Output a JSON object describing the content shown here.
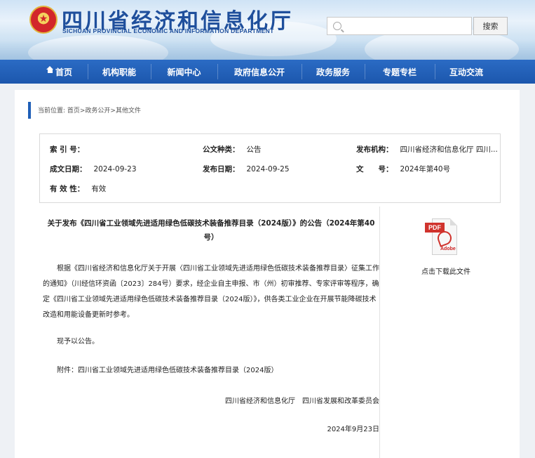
{
  "header": {
    "title": "四川省经济和信息化厅",
    "subtitle": "SICHUAN PROVINCIAL ECONOMIC AND INFORMATION DEPARTMENT",
    "search_placeholder": "",
    "search_button": "搜索"
  },
  "nav": {
    "items": [
      "首页",
      "机构职能",
      "新闻中心",
      "政府信息公开",
      "政务服务",
      "专题专栏",
      "互动交流"
    ]
  },
  "breadcrumb": "当前位置: 首页>政务公开>其他文件",
  "meta": {
    "index_label": "索 引 号：",
    "index_value": "",
    "category_label": "公文种类：",
    "category_value": "公告",
    "publisher_label": "发布机构：",
    "publisher_value": "四川省经济和信息化厅 四川...",
    "created_label": "成文日期：",
    "created_value": "2024-09-23",
    "published_label": "发布日期：",
    "published_value": "2024-09-25",
    "docno_label": "文　　号：",
    "docno_value": "2024年第40号",
    "validity_label": "有 效 性：",
    "validity_value": "有效"
  },
  "document": {
    "title": "关于发布《四川省工业领域先进适用绿色低碳技术装备推荐目录（2024版）》的公告（2024年第40号）",
    "body": "根据《四川省经济和信息化厅关于开展〈四川省工业领域先进适用绿色低碳技术装备推荐目录〉征集工作的通知》（川经信环资函〔2023〕284号）要求，经企业自主申报、市（州）初审推荐、专家评审等程序，确定《四川省工业领域先进适用绿色低碳技术装备推荐目录（2024版）》，供各类工业企业在开展节能降碳技术改造和用能设备更新时参考。",
    "announce": "现予以公告。",
    "attachment": "附件：四川省工业领域先进适用绿色低碳技术装备推荐目录（2024版）",
    "signers": "四川省经济和信息化厅　四川省发展和改革委员会",
    "date": "2024年9月23日"
  },
  "download": {
    "pdf_label": "PDF",
    "adobe_label": "Adobe",
    "text": "点击下载此文件"
  },
  "colors": {
    "nav_bg": "#1f5fb7",
    "title_blue": "#1f4f9c",
    "pdf_red": "#d0332d"
  }
}
